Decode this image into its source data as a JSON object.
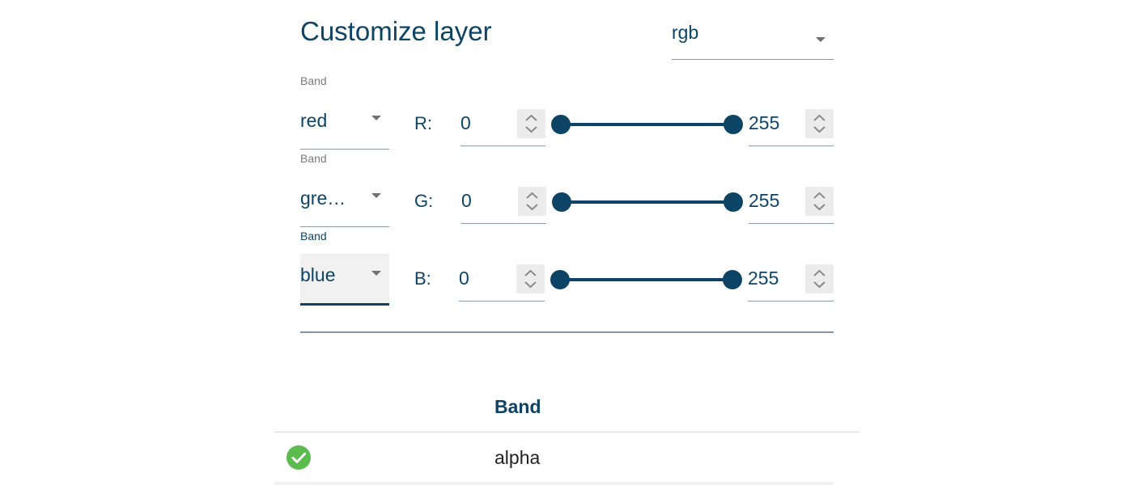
{
  "header": {
    "title": "Customize layer",
    "mode_select": {
      "value": "rgb"
    }
  },
  "channels": [
    {
      "band_label": "Band",
      "band_value": "red",
      "channel_label": "R:",
      "min": "0",
      "max": "255",
      "range_fraction": [
        0,
        1
      ]
    },
    {
      "band_label": "Band",
      "band_value": "gre…",
      "channel_label": "G:",
      "min": "0",
      "max": "255",
      "range_fraction": [
        0,
        1
      ]
    },
    {
      "band_label": "Band",
      "band_value": "blue",
      "channel_label": "B:",
      "min": "0",
      "max": "255",
      "range_fraction": [
        0,
        1
      ]
    }
  ],
  "table": {
    "columns": [
      "Band"
    ],
    "rows": [
      {
        "checked": true,
        "band": "alpha"
      }
    ]
  },
  "colors": {
    "primary": "#0d4466",
    "check": "#5cbb4f"
  },
  "icons": {
    "caret": "caret-down-icon",
    "spinner": "spinner-arrows-icon",
    "check": "check-circle-icon"
  }
}
